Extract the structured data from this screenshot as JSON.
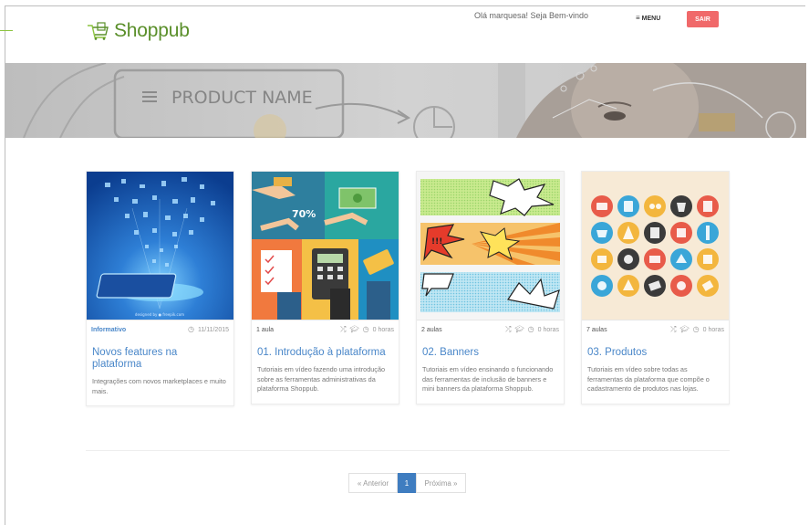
{
  "header": {
    "logo_text": "Shoppub",
    "greeting": "Olá marquesa! Seja Bem-vindo",
    "menu_label": "MENU",
    "logout_label": "SAIR"
  },
  "banner": {
    "product_name": "PRODUCT NAME"
  },
  "cards": [
    {
      "meta_left": "Informativo",
      "date": "11/11/2015",
      "title": "Novos features na plataforma",
      "description": "Integrações com novos marketplaces e muito mais."
    },
    {
      "meta_left": "1 aula",
      "hours": "0 horas",
      "title": "01. Introdução à plataforma",
      "description": "Tutoriais em vídeo fazendo uma introdução sobre as ferramentas administrativas da plataforma Shoppub."
    },
    {
      "meta_left": "2 aulas",
      "hours": "0 horas",
      "title": "02. Banners",
      "description": "Tutoriais em vídeo ensinando o funcionando das ferramentas de inclusão de banners e mini banners da plataforma Shoppub."
    },
    {
      "meta_left": "7 aulas",
      "hours": "0 horas",
      "title": "03. Produtos",
      "description": "Tutoriais em vídeo sobre todas as ferramentas da plataforma que compõe o cadastramento de produtos nas lojas."
    }
  ],
  "pagination": {
    "prev_label": "« Anterior",
    "current": "1",
    "next_label": "Próxima »"
  },
  "colors": {
    "brand_green": "#5a8f2a",
    "logout_red": "#f0696a",
    "link_blue": "#4a87c9",
    "pager_active": "#3f7dc0"
  }
}
